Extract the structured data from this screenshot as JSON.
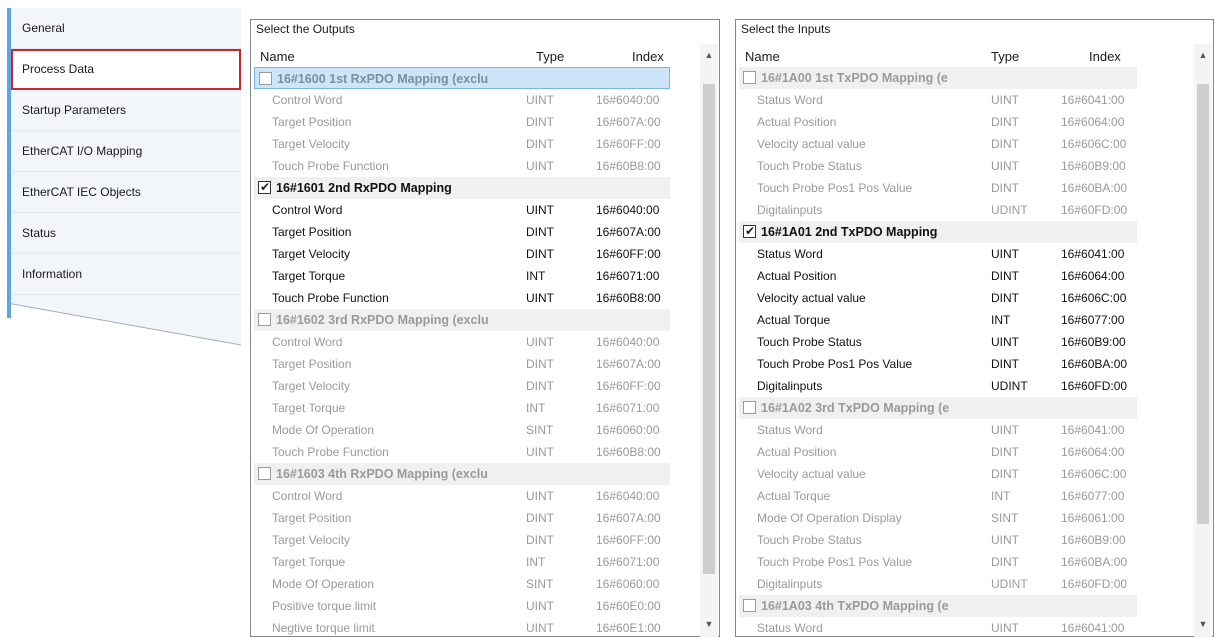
{
  "sidebar": {
    "items": [
      {
        "label": "General",
        "selected": false
      },
      {
        "label": "Process Data",
        "selected": true
      },
      {
        "label": "Startup Parameters",
        "selected": false
      },
      {
        "label": "EtherCAT I/O Mapping",
        "selected": false
      },
      {
        "label": "EtherCAT IEC Objects",
        "selected": false
      },
      {
        "label": "Status",
        "selected": false
      },
      {
        "label": "Information",
        "selected": false
      }
    ]
  },
  "outputs": {
    "caption": "Select the Outputs",
    "columns": {
      "name": "Name",
      "type": "Type",
      "index": "Index"
    },
    "rows": [
      {
        "kind": "group",
        "checked": false,
        "enabled": false,
        "highlight": true,
        "name": "16#1600 1st RxPDO Mapping (exclu",
        "type": "",
        "index": ""
      },
      {
        "kind": "item",
        "enabled": false,
        "name": "Control Word",
        "type": "UINT",
        "index": "16#6040:00"
      },
      {
        "kind": "item",
        "enabled": false,
        "name": "Target Position",
        "type": "DINT",
        "index": "16#607A:00"
      },
      {
        "kind": "item",
        "enabled": false,
        "name": "Target Velocity",
        "type": "DINT",
        "index": "16#60FF:00"
      },
      {
        "kind": "item",
        "enabled": false,
        "name": "Touch Probe Function",
        "type": "UINT",
        "index": "16#60B8:00"
      },
      {
        "kind": "group",
        "checked": true,
        "enabled": true,
        "highlight": false,
        "name": "16#1601 2nd RxPDO Mapping",
        "type": "",
        "index": ""
      },
      {
        "kind": "item",
        "enabled": true,
        "name": "Control Word",
        "type": "UINT",
        "index": "16#6040:00"
      },
      {
        "kind": "item",
        "enabled": true,
        "name": "Target Position",
        "type": "DINT",
        "index": "16#607A:00"
      },
      {
        "kind": "item",
        "enabled": true,
        "name": "Target Velocity",
        "type": "DINT",
        "index": "16#60FF:00"
      },
      {
        "kind": "item",
        "enabled": true,
        "name": "Target Torque",
        "type": "INT",
        "index": "16#6071:00"
      },
      {
        "kind": "item",
        "enabled": true,
        "name": "Touch Probe Function",
        "type": "UINT",
        "index": "16#60B8:00"
      },
      {
        "kind": "group",
        "checked": false,
        "enabled": false,
        "highlight": false,
        "name": "16#1602 3rd RxPDO Mapping (exclu",
        "type": "",
        "index": ""
      },
      {
        "kind": "item",
        "enabled": false,
        "name": "Control Word",
        "type": "UINT",
        "index": "16#6040:00"
      },
      {
        "kind": "item",
        "enabled": false,
        "name": "Target Position",
        "type": "DINT",
        "index": "16#607A:00"
      },
      {
        "kind": "item",
        "enabled": false,
        "name": "Target Velocity",
        "type": "DINT",
        "index": "16#60FF:00"
      },
      {
        "kind": "item",
        "enabled": false,
        "name": "Target Torque",
        "type": "INT",
        "index": "16#6071:00"
      },
      {
        "kind": "item",
        "enabled": false,
        "name": "Mode Of Operation",
        "type": "SINT",
        "index": "16#6060:00"
      },
      {
        "kind": "item",
        "enabled": false,
        "name": "Touch Probe Function",
        "type": "UINT",
        "index": "16#60B8:00"
      },
      {
        "kind": "group",
        "checked": false,
        "enabled": false,
        "highlight": false,
        "name": "16#1603 4th RxPDO Mapping (exclu",
        "type": "",
        "index": ""
      },
      {
        "kind": "item",
        "enabled": false,
        "name": "Control Word",
        "type": "UINT",
        "index": "16#6040:00"
      },
      {
        "kind": "item",
        "enabled": false,
        "name": "Target Position",
        "type": "DINT",
        "index": "16#607A:00"
      },
      {
        "kind": "item",
        "enabled": false,
        "name": "Target Velocity",
        "type": "DINT",
        "index": "16#60FF:00"
      },
      {
        "kind": "item",
        "enabled": false,
        "name": "Target Torque",
        "type": "INT",
        "index": "16#6071:00"
      },
      {
        "kind": "item",
        "enabled": false,
        "name": "Mode Of Operation",
        "type": "SINT",
        "index": "16#6060:00"
      },
      {
        "kind": "item",
        "enabled": false,
        "name": "Positive torque limit",
        "type": "UINT",
        "index": "16#60E0:00"
      },
      {
        "kind": "item",
        "enabled": false,
        "name": "Negtive torque limit",
        "type": "UINT",
        "index": "16#60E1:00"
      }
    ]
  },
  "inputs": {
    "caption": "Select the Inputs",
    "columns": {
      "name": "Name",
      "type": "Type",
      "index": "Index"
    },
    "rows": [
      {
        "kind": "group",
        "checked": false,
        "enabled": false,
        "highlight": false,
        "name": "16#1A00 1st TxPDO Mapping (e",
        "type": "",
        "index": ""
      },
      {
        "kind": "item",
        "enabled": false,
        "name": "Status Word",
        "type": "UINT",
        "index": "16#6041:00"
      },
      {
        "kind": "item",
        "enabled": false,
        "name": "Actual Position",
        "type": "DINT",
        "index": "16#6064:00"
      },
      {
        "kind": "item",
        "enabled": false,
        "name": "Velocity actual value",
        "type": "DINT",
        "index": "16#606C:00"
      },
      {
        "kind": "item",
        "enabled": false,
        "name": "Touch Probe Status",
        "type": "UINT",
        "index": "16#60B9:00"
      },
      {
        "kind": "item",
        "enabled": false,
        "name": "Touch Probe Pos1 Pos Value",
        "type": "DINT",
        "index": "16#60BA:00"
      },
      {
        "kind": "item",
        "enabled": false,
        "name": "Digitalinputs",
        "type": "UDINT",
        "index": "16#60FD:00"
      },
      {
        "kind": "group",
        "checked": true,
        "enabled": true,
        "highlight": false,
        "name": "16#1A01 2nd TxPDO Mapping",
        "type": "",
        "index": ""
      },
      {
        "kind": "item",
        "enabled": true,
        "name": "Status Word",
        "type": "UINT",
        "index": "16#6041:00"
      },
      {
        "kind": "item",
        "enabled": true,
        "name": "Actual Position",
        "type": "DINT",
        "index": "16#6064:00"
      },
      {
        "kind": "item",
        "enabled": true,
        "name": "Velocity actual value",
        "type": "DINT",
        "index": "16#606C:00"
      },
      {
        "kind": "item",
        "enabled": true,
        "name": "Actual Torque",
        "type": "INT",
        "index": "16#6077:00"
      },
      {
        "kind": "item",
        "enabled": true,
        "name": "Touch Probe Status",
        "type": "UINT",
        "index": "16#60B9:00"
      },
      {
        "kind": "item",
        "enabled": true,
        "name": "Touch Probe Pos1 Pos Value",
        "type": "DINT",
        "index": "16#60BA:00"
      },
      {
        "kind": "item",
        "enabled": true,
        "name": "Digitalinputs",
        "type": "UDINT",
        "index": "16#60FD:00"
      },
      {
        "kind": "group",
        "checked": false,
        "enabled": false,
        "highlight": false,
        "name": "16#1A02 3rd TxPDO Mapping (e",
        "type": "",
        "index": ""
      },
      {
        "kind": "item",
        "enabled": false,
        "name": "Status Word",
        "type": "UINT",
        "index": "16#6041:00"
      },
      {
        "kind": "item",
        "enabled": false,
        "name": "Actual Position",
        "type": "DINT",
        "index": "16#6064:00"
      },
      {
        "kind": "item",
        "enabled": false,
        "name": "Velocity actual value",
        "type": "DINT",
        "index": "16#606C:00"
      },
      {
        "kind": "item",
        "enabled": false,
        "name": "Actual Torque",
        "type": "INT",
        "index": "16#6077:00"
      },
      {
        "kind": "item",
        "enabled": false,
        "name": "Mode Of Operation Display",
        "type": "SINT",
        "index": "16#6061:00"
      },
      {
        "kind": "item",
        "enabled": false,
        "name": "Touch Probe Status",
        "type": "UINT",
        "index": "16#60B9:00"
      },
      {
        "kind": "item",
        "enabled": false,
        "name": "Touch Probe Pos1 Pos Value",
        "type": "DINT",
        "index": "16#60BA:00"
      },
      {
        "kind": "item",
        "enabled": false,
        "name": "Digitalinputs",
        "type": "UDINT",
        "index": "16#60FD:00"
      },
      {
        "kind": "group",
        "checked": false,
        "enabled": false,
        "highlight": false,
        "name": "16#1A03 4th TxPDO Mapping (e",
        "type": "",
        "index": ""
      },
      {
        "kind": "item",
        "enabled": false,
        "name": "Status Word",
        "type": "UINT",
        "index": "16#6041:00"
      }
    ]
  },
  "scrollbar": {
    "up_icon": "chevron-up-icon",
    "down_icon": "chevron-down-icon"
  },
  "colors": {
    "selection_border": "#c8282d",
    "nav_accent": "#5aa7e6",
    "row_highlight": "#cde5f8",
    "disabled_text": "#9a9a9a"
  }
}
